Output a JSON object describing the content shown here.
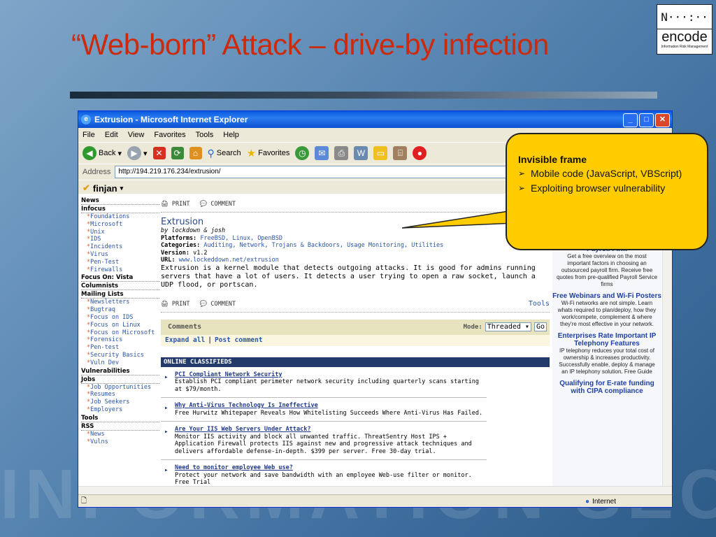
{
  "slide": {
    "title": "“Web-born” Attack – drive-by infection",
    "logo_word": "encode",
    "logo_sub": "Information Risk Management",
    "bg_word": "INFORMATION SECURITY"
  },
  "browser": {
    "window_title": "Extrusion - Microsoft Internet Explorer",
    "menu": [
      "File",
      "Edit",
      "View",
      "Favorites",
      "Tools",
      "Help"
    ],
    "toolbar": {
      "back": "Back",
      "search": "Search",
      "favorites": "Favorites"
    },
    "address_label": "Address",
    "address_value": "http://194.219.176.234/extrusion/",
    "finjan": "finjan",
    "status_zone": "Internet"
  },
  "nav": {
    "news": "News",
    "infocus": "Infocus",
    "infocus_items": [
      "Foundations",
      "Microsoft",
      "Unix",
      "IDS",
      "Incidents",
      "Virus",
      "Pen-Test",
      "Firewalls"
    ],
    "focus_vista": "Focus On: Vista",
    "columnists": "Columnists",
    "mailing": "Mailing Lists",
    "mailing_items": [
      "Newsletters",
      "Bugtraq",
      "Focus on IDS",
      "Focus on Linux",
      "Focus on Microsoft",
      "Forensics",
      "Pen-test",
      "Security Basics",
      "Vuln Dev"
    ],
    "vulnerabilities": "Vulnerabilities",
    "jobs": "Jobs",
    "jobs_items": [
      "Job Opportunities",
      "Resumes",
      "Job Seekers",
      "Employers"
    ],
    "tools": "Tools",
    "rss": "RSS",
    "rss_items": [
      "News",
      "Vulns"
    ]
  },
  "article": {
    "print": "PRINT",
    "comment": "COMMENT",
    "title": "Extrusion",
    "byline": "by lockdown & josh",
    "platforms_label": "Platforms:",
    "platforms": "FreeBSD, Linux, OpenBSD",
    "categories_label": "Categories:",
    "categories": "Auditing, Network, Trojans & Backdoors, Usage Monitoring, Utilities",
    "version_label": "Version:",
    "version": "v1.2",
    "url_label": "URL:",
    "url": "www.lockeddown.net/extrusion",
    "description": "Extrusion is a kernel module that detects outgoing attacks. It is good for admins running servers that have a lot of users. It detects a user trying to open a raw socket, launch a UDP flood, or portscan.",
    "tools": "Tools"
  },
  "comments": {
    "header": "Comments",
    "mode_label": "Mode:",
    "mode_value": "Threaded",
    "go": "Go",
    "expand": "Expand all",
    "post": "Post comment"
  },
  "classifieds": {
    "header": "ONLINE CLASSIFIEDS",
    "ads": [
      {
        "title": "PCI Compliant Network Security",
        "text": "Establish PCI compliant perimeter network security including quarterly scans starting at $79/month."
      },
      {
        "title": "Why Anti-Virus Technology Is Ineffective",
        "text": "Free Hurwitz Whitepaper Reveals How Whitelisting Succeeds Where Anti-Virus Has Failed."
      },
      {
        "title": "Are Your IIS Web Servers Under Attack?",
        "text": "Monitor IIS activity and block all unwanted traffic. ThreatSentry Host IPS + Application Firewall protects IIS against new and progressive attack techniques and delivers affordable defense-in-depth. $399 per server. Free 30-day trial."
      },
      {
        "title": "Need to monitor employee Web use?",
        "text": "Protect your network and save bandwidth with an employee Web-use filter or monitor. Free Trial"
      }
    ]
  },
  "rightcol": [
    {
      "head": "Payroll Firm",
      "text": "Get a free overview on the most important factors in choosing an outsourced payroll firm. Receive free quotes from pre-qualified Payroll Service firms"
    },
    {
      "head": "Free Webinars and Wi-Fi Posters",
      "text": "Wi-Fi networks are not simple. Learn whats required to plan/deploy, how they work/compete, complement & where they're most effective in your network."
    },
    {
      "head": "Enterprises Rate Important IP Telephony Features",
      "text": "IP telephony reduces your total cost of ownership & increases productivity. Successfully enable, deploy & manage an IP telephony solution. Free Guide"
    },
    {
      "head": "Qualifying for E-rate funding with CIPA compliance",
      "text": ""
    }
  ],
  "callout": {
    "title": "Invisible frame",
    "items": [
      "Mobile code (JavaScript, VBScript)",
      "Exploiting browser vulnerability"
    ]
  }
}
